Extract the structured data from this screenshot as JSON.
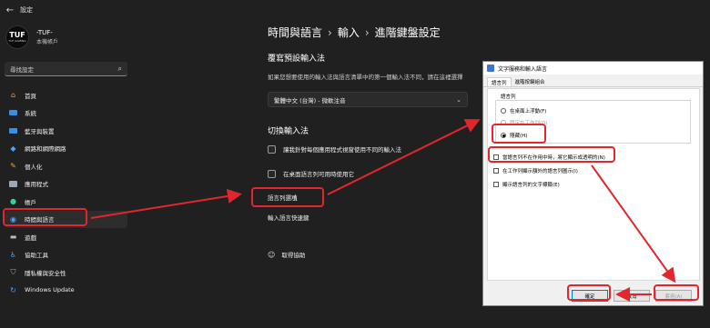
{
  "window": {
    "back_icon": "back-arrow-icon",
    "title": "設定"
  },
  "user": {
    "logo_mark": "TUF",
    "logo_sub": "TUF GAMING",
    "name": "-TUF-",
    "subtitle": "本機帳戶"
  },
  "sidebar": {
    "search_placeholder": "尋找設定",
    "items": [
      {
        "label": "首頁",
        "icon": "home-icon"
      },
      {
        "label": "系統",
        "icon": "system-icon"
      },
      {
        "label": "藍牙與裝置",
        "icon": "bluetooth-icon"
      },
      {
        "label": "網路和網際網路",
        "icon": "wifi-icon"
      },
      {
        "label": "個人化",
        "icon": "brush-icon"
      },
      {
        "label": "應用程式",
        "icon": "apps-icon"
      },
      {
        "label": "帳戶",
        "icon": "account-icon"
      },
      {
        "label": "時間與語言",
        "icon": "globe-icon",
        "active": true
      },
      {
        "label": "遊戲",
        "icon": "gamepad-icon"
      },
      {
        "label": "協助工具",
        "icon": "accessibility-icon"
      },
      {
        "label": "隱私權與安全性",
        "icon": "shield-icon"
      },
      {
        "label": "Windows Update",
        "icon": "update-icon"
      }
    ]
  },
  "main": {
    "breadcrumb": [
      "時間與語言",
      "輸入",
      "進階鍵盤設定"
    ],
    "override_title": "覆寫預設輸入法",
    "override_desc": "如果您想要使用的輸入法與語言清單中的第一個輸入法不同，請在這裡選擇",
    "dropdown_value": "繁體中文 (台灣) - 微軟注音",
    "switch_title": "切換輸入法",
    "checkbox1": "讓我針對每個應用程式視窗使用不同的輸入法",
    "checkbox2": "在桌面語言列可用時使用它",
    "link_language_bar": "語言列選項",
    "link_hotkeys": "輸入語言快速鍵",
    "help": "取得協助"
  },
  "dialog": {
    "title": "文字服務和輸入語言",
    "tabs": [
      "語言列",
      "進階按鍵組合"
    ],
    "group_title": "語言列",
    "radios": [
      {
        "label": "在桌面上浮動(F)",
        "state": "off"
      },
      {
        "label": "固定在工作列(D)",
        "state": "disabled"
      },
      {
        "label": "隱藏(H)",
        "state": "on"
      }
    ],
    "checks": [
      "當語言列不在作用中時，將它顯示成透明的(N)",
      "在工作列顯示額外的語言列圖示(I)",
      "顯示語言列的文字標籤(E)"
    ],
    "buttons": {
      "ok": "確定",
      "cancel": "取消",
      "apply": "套用(A)"
    }
  },
  "colors": {
    "background": "#202020",
    "annotation": "#e3262d",
    "accent": "#0078d7"
  }
}
